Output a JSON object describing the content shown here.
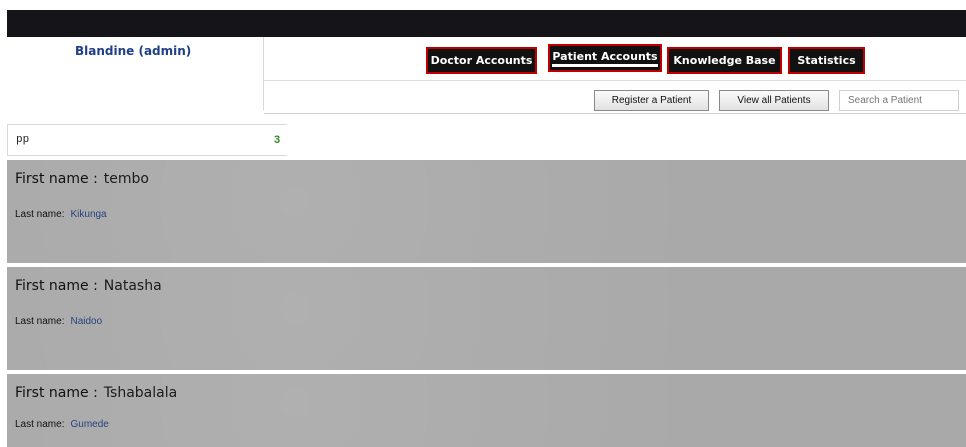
{
  "header": {
    "user_label": "Blandine (admin)"
  },
  "nav": {
    "tabs": [
      {
        "label": "Doctor Accounts"
      },
      {
        "label": "Patient Accounts",
        "active": true
      },
      {
        "label": "Knowledge Base"
      },
      {
        "label": "Statistics"
      }
    ]
  },
  "actions": {
    "register": "Register a Patient",
    "view_all": "View all Patients",
    "search_placeholder": "Search a Patient"
  },
  "filter": {
    "query": "pp",
    "count": "3"
  },
  "patients": {
    "first_label": "First name :",
    "last_label": "Last name:",
    "items": [
      {
        "first": "tembo",
        "last": "Kikunga"
      },
      {
        "first": "Natasha",
        "last": "Naidoo"
      },
      {
        "first": "Tshabalala",
        "last": "Gumede"
      }
    ]
  },
  "colors": {
    "topbar": "#141419",
    "tab_border": "#c00000",
    "username": "#1f3f86",
    "record_bg": "#a9a9a9",
    "count": "#2a8a2a"
  }
}
